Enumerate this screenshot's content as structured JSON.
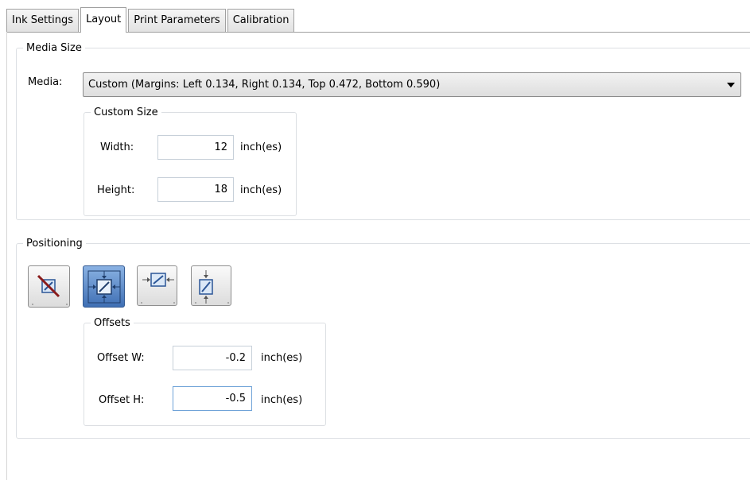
{
  "tabs": [
    {
      "label": "Ink Settings",
      "active": false
    },
    {
      "label": "Layout",
      "active": true
    },
    {
      "label": "Print Parameters",
      "active": false
    },
    {
      "label": "Calibration",
      "active": false
    }
  ],
  "media_size": {
    "title": "Media Size",
    "media_label": "Media:",
    "media_value": "Custom (Margins: Left 0.134, Right 0.134, Top 0.472, Bottom 0.590)",
    "custom_size": {
      "title": "Custom Size",
      "width_label": "Width:",
      "width_value": "12",
      "height_label": "Height:",
      "height_value": "18",
      "unit": "inch(es)"
    }
  },
  "positioning": {
    "title": "Positioning",
    "buttons": [
      {
        "icon": "no-positioning-icon",
        "selected": false
      },
      {
        "icon": "center-both-icon",
        "selected": true
      },
      {
        "icon": "center-horizontal-icon",
        "selected": false
      },
      {
        "icon": "center-vertical-icon",
        "selected": false
      }
    ],
    "offsets": {
      "title": "Offsets",
      "offset_w_label": "Offset W:",
      "offset_w_value": "-0.2",
      "offset_h_label": "Offset H:",
      "offset_h_value": "-0.5",
      "unit": "inch(es)"
    }
  },
  "colors": {
    "selected_button": "#4a7ec4",
    "focus_border": "#6fa3d8"
  }
}
